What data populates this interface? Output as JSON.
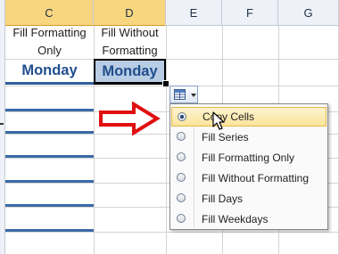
{
  "columns": [
    "C",
    "D",
    "E",
    "F",
    "G"
  ],
  "header_row": {
    "c_text_line1": "Fill Formatting",
    "c_text_line2": "Only",
    "d_text_line1": "Fill Without",
    "d_text_line2": "Formatting"
  },
  "cells": {
    "c_value": "Monday",
    "d_value": "Monday"
  },
  "autofill_button": {
    "icon": "autofill-options-icon"
  },
  "menu": {
    "items": [
      {
        "label": "Copy Cells",
        "selected": true
      },
      {
        "label": "Fill Series",
        "selected": false
      },
      {
        "label": "Fill Formatting Only",
        "selected": false
      },
      {
        "label": "Fill Without Formatting",
        "selected": false
      },
      {
        "label": "Fill Days",
        "selected": false
      },
      {
        "label": "Fill Weekdays",
        "selected": false
      }
    ]
  },
  "colors": {
    "selected_header": "#f8d680",
    "highlight_fill": "#b8cce4",
    "text_blue": "#1f4e8c",
    "arrow_red": "#e01010"
  }
}
